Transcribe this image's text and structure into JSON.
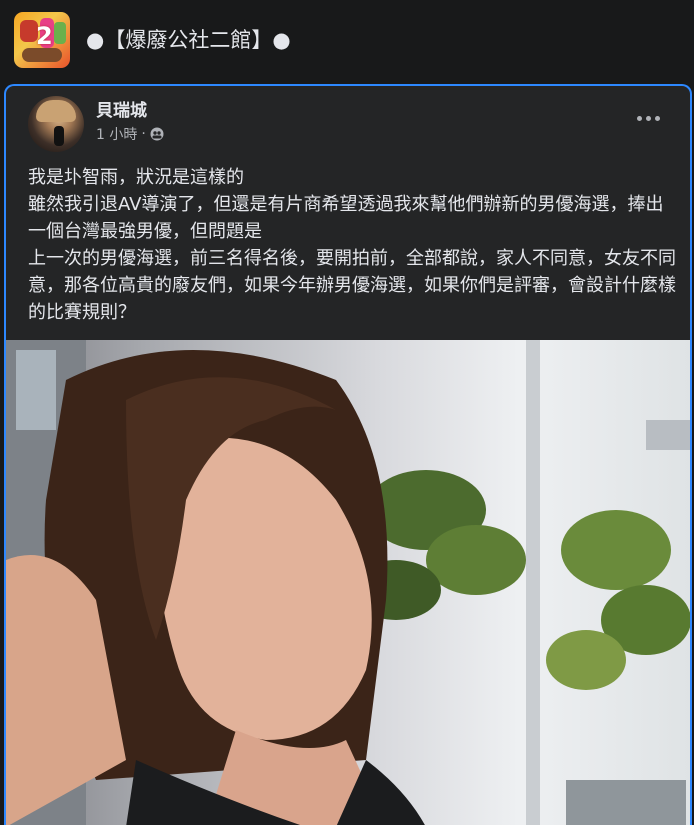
{
  "group": {
    "logo_text": "2",
    "name": "●【爆廢公社二館】●"
  },
  "post": {
    "author": "貝瑞城",
    "time": "1 小時",
    "separator": "·",
    "audience_icon": "friends-icon",
    "more_icon": "more-options-icon",
    "text_lines": [
      "我是圤智雨，狀況是這樣的",
      "雖然我引退AV導演了，但還是有片商希望透過我來幫他們辦新的男優海選，捧出一個台灣最強男優，但問題是",
      "上一次的男優海選，前三名得名後，要開拍前，全部都說，家人不同意，女友不同意，那各位高貴的廢友們，如果今年辦男優海選，如果你們是評審，會設計什麼樣的比賽規則？"
    ],
    "image_description": "photo-young-man-long-hair-black-tank-top-plants-window"
  },
  "colors": {
    "background": "#18191a",
    "card": "#242526",
    "accent": "#2d88ff",
    "text": "#e4e6eb",
    "secondary_text": "#b0b3b8"
  }
}
